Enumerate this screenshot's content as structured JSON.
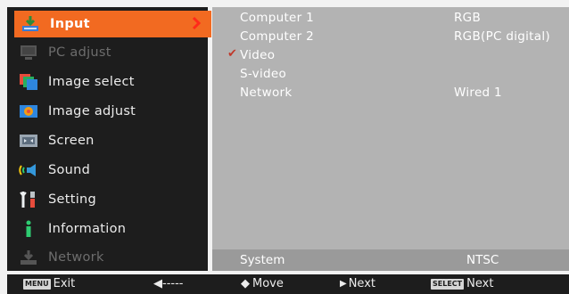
{
  "menu": {
    "items": [
      {
        "label": "Input",
        "icon": "input-icon"
      },
      {
        "label": "PC adjust",
        "icon": "pc-adjust-icon"
      },
      {
        "label": "Image select",
        "icon": "image-select-icon"
      },
      {
        "label": "Image adjust",
        "icon": "image-adjust-icon"
      },
      {
        "label": "Screen",
        "icon": "screen-icon"
      },
      {
        "label": "Sound",
        "icon": "sound-icon"
      },
      {
        "label": "Setting",
        "icon": "setting-icon"
      },
      {
        "label": "Information",
        "icon": "information-icon"
      },
      {
        "label": "Network",
        "icon": "network-icon"
      }
    ]
  },
  "panel": {
    "rows": [
      {
        "name": "Computer 1",
        "value": "RGB"
      },
      {
        "name": "Computer 2",
        "value": "RGB(PC digital)"
      },
      {
        "name": "Video",
        "value": "",
        "check": "✔"
      },
      {
        "name": "S-video",
        "value": ""
      },
      {
        "name": "Network",
        "value": "Wired 1"
      }
    ],
    "system": {
      "name": "System",
      "value": "NTSC"
    }
  },
  "footer": {
    "exit_key": "MENU",
    "exit_label": "Exit",
    "back_label": "◀-----",
    "move_label": "Move",
    "move_arrow": "◆",
    "next_arrow": "▶",
    "next_label": "Next",
    "select_key": "SELECT",
    "select_label": "Next"
  },
  "colors": {
    "accent": "#f26a21",
    "menu_bg": "#1d1d1d",
    "panel_bg": "#b3b3b3",
    "check": "#c0392b"
  }
}
